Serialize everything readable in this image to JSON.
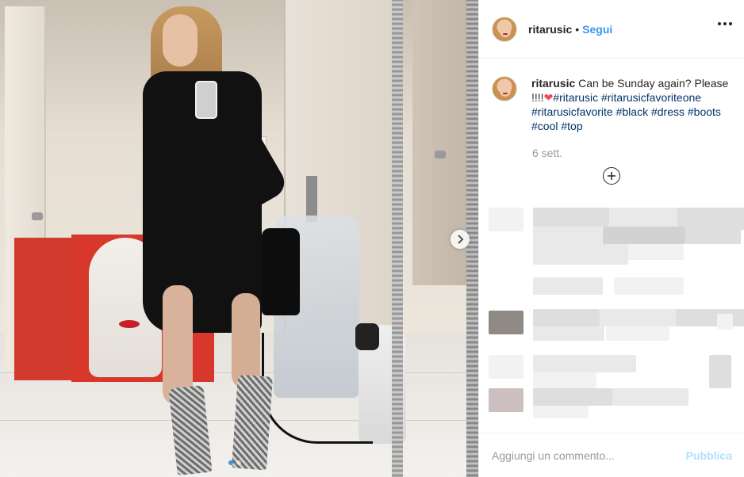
{
  "post": {
    "username": "ritarusic",
    "follow_label": "Segui",
    "separator": "•",
    "more_icon": "more-options-icon"
  },
  "caption": {
    "username": "ritarusic",
    "text": "Can be Sunday again? Please !!!!",
    "heart": "❤",
    "hashtags": [
      "#ritarusic",
      "#ritarusicfavoriteone",
      "#ritarusicfavorite",
      "#black",
      "#dress",
      "#boots",
      "#cool",
      "#top"
    ]
  },
  "timestamp": "6 sett.",
  "load_more_icon": "plus-circle-icon",
  "carousel": {
    "next_icon": "chevron-right-icon",
    "total_slides": 2,
    "active_slide": 1
  },
  "comment_box": {
    "placeholder": "Aggiungi un commento...",
    "publish_label": "Pubblica"
  },
  "colors": {
    "link_blue": "#3897f0",
    "hashtag": "#003569",
    "publish_disabled": "#b2dffc",
    "heart": "#ed4956"
  }
}
